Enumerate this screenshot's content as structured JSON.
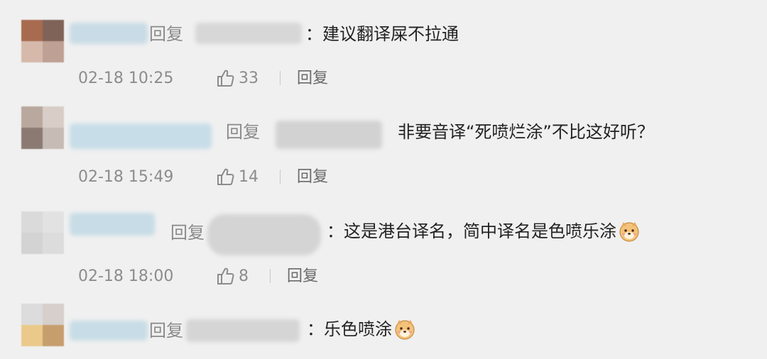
{
  "comments": [
    {
      "reply_word": "回复",
      "text": "：建议翻译屎不拉通",
      "time": "02-18 10:25",
      "likes": "33",
      "reply_label": "回复",
      "has_emoji": false,
      "avatar_colors": [
        "#a06a55",
        "#8d6a5a",
        "#c9a08c",
        "#b88a76"
      ]
    },
    {
      "reply_word": "回复",
      "text": "非要音译“死喷烂涂”不比这好听？",
      "time": "02-18 15:49",
      "likes": "14",
      "reply_label": "回复",
      "has_emoji": false,
      "avatar_colors": [
        "#b8a59a",
        "#d8cfc8",
        "#8d7b73",
        "#c7bdb6"
      ]
    },
    {
      "reply_word": "回复",
      "text": "：这是港台译名，简中译名是色喷乐涂",
      "time": "02-18 18:00",
      "likes": "8",
      "reply_label": "回复",
      "has_emoji": true,
      "emoji_name": "doge-emoji",
      "avatar_colors": [
        "#dcdcdc",
        "#e4e4e4",
        "#d4d4d4",
        "#dedede"
      ]
    },
    {
      "reply_word": "回复",
      "text": "：乐色喷涂",
      "has_emoji": true,
      "emoji_name": "doge-emoji",
      "avatar_colors": [
        "#dcdcdc",
        "#d6d0cc",
        "#e8c98a",
        "#c9a070"
      ]
    }
  ],
  "icons": {
    "like": "thumbs-up-icon"
  }
}
